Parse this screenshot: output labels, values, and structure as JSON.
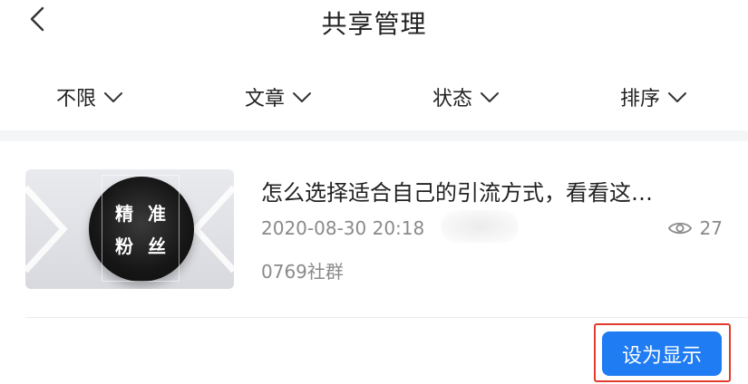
{
  "header": {
    "title": "共享管理",
    "back_icon": "chevron-left-icon"
  },
  "filters": [
    {
      "label": "不限",
      "icon": "chevron-down-icon"
    },
    {
      "label": "文章",
      "icon": "chevron-down-icon"
    },
    {
      "label": "状态",
      "icon": "chevron-down-icon"
    },
    {
      "label": "排序",
      "icon": "chevron-down-icon"
    }
  ],
  "article": {
    "thumbnail_text": [
      "精",
      "准",
      "粉",
      "丝"
    ],
    "title": "怎么选择适合自己的引流方式，看看这…",
    "date": "2020-08-30 20:18",
    "views": "27",
    "views_icon": "eye-icon",
    "source": "0769社群",
    "action_label": "设为显示"
  },
  "colors": {
    "accent": "#1f7cf2",
    "highlight_border": "#e23b2e",
    "meta_text": "#8a8a8a",
    "separator": "#f4f5f7"
  }
}
